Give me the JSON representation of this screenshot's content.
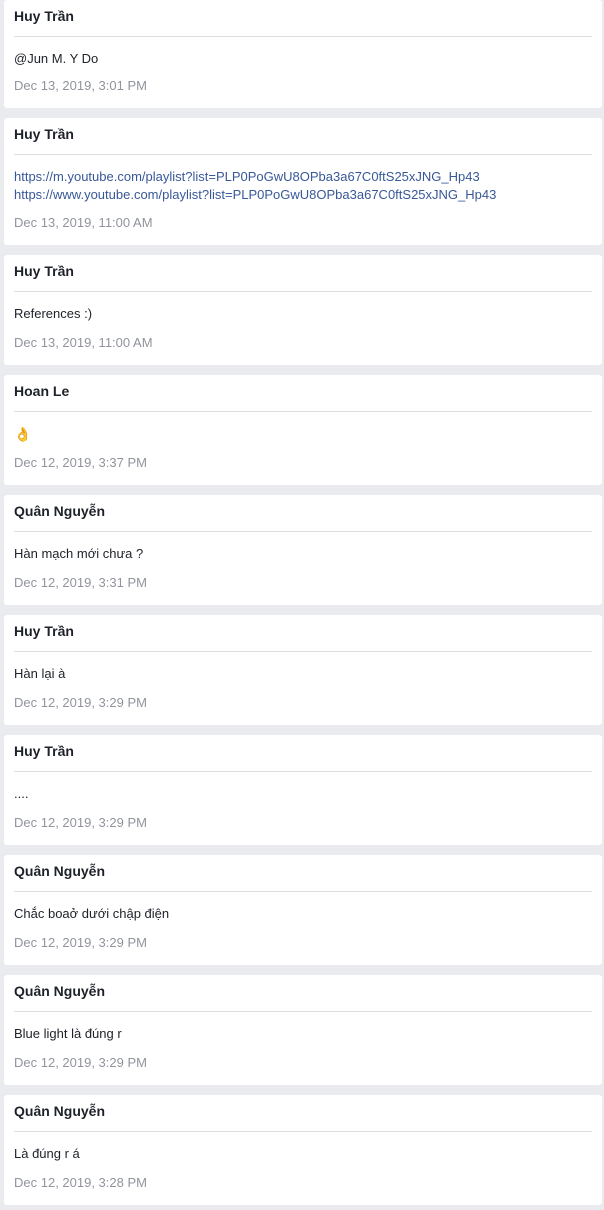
{
  "messages": [
    {
      "author": "Huy Trần",
      "text": "@Jun M. Y Do",
      "time": "Dec 13, 2019, 3:01 PM"
    },
    {
      "author": "Huy Trần",
      "links": [
        "https://m.youtube.com/playlist?list=PLP0PoGwU8OPba3a67C0ftS25xJNG_Hp43",
        "https://www.youtube.com/playlist?list=PLP0PoGwU8OPba3a67C0ftS25xJNG_Hp43"
      ],
      "time": "Dec 13, 2019, 11:00 AM"
    },
    {
      "author": "Huy Trần",
      "text": "References :)",
      "time": "Dec 13, 2019, 11:00 AM"
    },
    {
      "author": "Hoan Le",
      "text": "👌",
      "time": "Dec 12, 2019, 3:37 PM"
    },
    {
      "author": "Quân Nguyễn",
      "text": "Hàn mạch mới chưa ?",
      "time": "Dec 12, 2019, 3:31 PM"
    },
    {
      "author": "Huy Trần",
      "text": "Hàn lại à",
      "time": "Dec 12, 2019, 3:29 PM"
    },
    {
      "author": "Huy Trần",
      "text": "....",
      "time": "Dec 12, 2019, 3:29 PM"
    },
    {
      "author": "Quân Nguyễn",
      "text": "Chắc boaở dưới chập điện",
      "time": "Dec 12, 2019, 3:29 PM"
    },
    {
      "author": "Quân Nguyễn",
      "text": "Blue light là đúng r",
      "time": "Dec 12, 2019, 3:29 PM"
    },
    {
      "author": "Quân Nguyễn",
      "text": "Là đúng r á",
      "time": "Dec 12, 2019, 3:28 PM"
    }
  ]
}
